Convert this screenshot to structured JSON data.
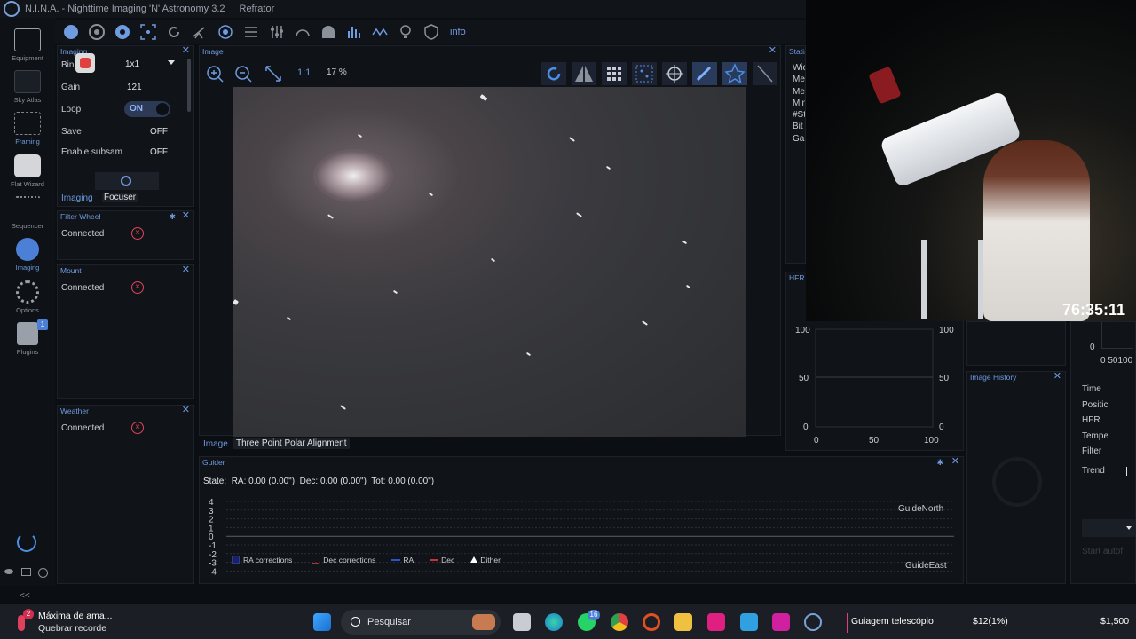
{
  "titlebar": {
    "title": "N.I.N.A. - Nighttime Imaging 'N' Astronomy 3.2",
    "profile": "Refrator"
  },
  "sidebar": {
    "items": [
      {
        "label": "Equipment"
      },
      {
        "label": "Sky Atlas"
      },
      {
        "label": "Framing"
      },
      {
        "label": "Flat Wizard"
      },
      {
        "label": "Sequencer"
      },
      {
        "label": "Imaging"
      },
      {
        "label": "Options"
      },
      {
        "label": "Plugins"
      }
    ],
    "plugins_badge": "1",
    "collapse": "<<"
  },
  "toolbar": {
    "info_label": "info"
  },
  "imaging_panel": {
    "title": "Imaging",
    "bin_label": "Binn",
    "bin_value": "1x1",
    "gain_label": "Gain",
    "gain_value": "121",
    "loop_label": "Loop",
    "loop_value": "ON",
    "save_label": "Save",
    "save_value": "OFF",
    "subsam_label": "Enable subsam",
    "subsam_value": "OFF",
    "tab_imaging": "Imaging",
    "tab_focuser": "Focuser"
  },
  "filter_wheel": {
    "title": "Filter Wheel",
    "status": "Connected"
  },
  "mount": {
    "title": "Mount",
    "status": "Connected"
  },
  "weather": {
    "title": "Weather",
    "status": "Connected"
  },
  "image_panel": {
    "title": "Image",
    "zoom_label": "1:1",
    "zoom_pct": "17 %",
    "tab_image": "Image",
    "tab_tppa": "Three Point Polar Alignment"
  },
  "statistics": {
    "title": "Statisti",
    "rows": [
      "Wid",
      "Mea",
      "Med",
      "Min",
      "#Sta",
      "Bit d",
      "Gai"
    ]
  },
  "hfr_panel": {
    "title": "HFR h"
  },
  "hfr_chart": {
    "y_left": [
      "100",
      "50",
      "0"
    ],
    "y_right": [
      "100",
      "50",
      "0"
    ],
    "x_ticks": [
      "0",
      "50",
      "100"
    ]
  },
  "image_history": {
    "title": "Image History"
  },
  "right_info": {
    "rows": [
      "Time",
      "Positic",
      "HFR",
      "Tempe",
      "Filter"
    ],
    "trend": "Trend",
    "start": "Start autof",
    "mini_ticks": "0 50100",
    "mini_zero": "0"
  },
  "guider": {
    "title": "Guider",
    "state": "State:",
    "ra": "RA: 0.00 (0.00\")",
    "dec": "Dec: 0.00 (0.00\")",
    "tot": "Tot: 0.00 (0.00\")",
    "y_ticks": [
      "4",
      "3",
      "2",
      "1",
      "0",
      "-1",
      "-2",
      "-3",
      "-4"
    ],
    "label_north": "GuideNorth",
    "label_east": "GuideEast",
    "legend": [
      "RA corrections",
      "Dec corrections",
      "RA",
      "Dec",
      "Dither"
    ]
  },
  "stream": {
    "timer": "76:35:11"
  },
  "taskbar": {
    "notif_title": "Máxima de ama...",
    "notif_sub": "Quebrar recorde",
    "notif_badge": "2",
    "search": "Pesquisar",
    "whatsapp_badge": "16",
    "track": "Guiagem telescópio",
    "stock": "$12(1%)",
    "price": "$1,500"
  }
}
